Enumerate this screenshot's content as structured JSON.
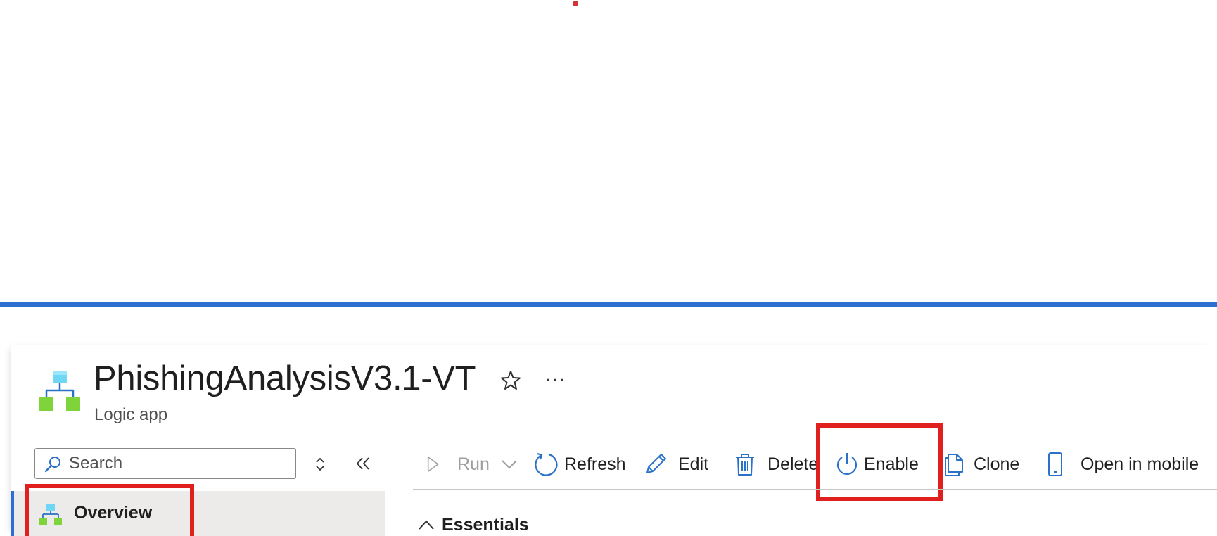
{
  "resource": {
    "title": "PhishingAnalysisV3.1-VT",
    "type": "Logic app",
    "icon": "logic-app-icon"
  },
  "header_actions": {
    "favorite_icon": "star-icon",
    "more_label": "···"
  },
  "sidebar": {
    "search_placeholder": "Search",
    "search_icon": "search-icon",
    "expand_icon": "up-down-chevron-icon",
    "collapse_icon": "double-chevron-left-icon",
    "items": [
      {
        "label": "Overview",
        "icon": "logic-app-icon",
        "selected": true
      }
    ]
  },
  "toolbar": {
    "run_label": "Run",
    "refresh_label": "Refresh",
    "edit_label": "Edit",
    "delete_label": "Delete",
    "enable_label": "Enable",
    "clone_label": "Clone",
    "open_mobile_label": "Open in mobile"
  },
  "main": {
    "essentials_label": "Essentials"
  },
  "colors": {
    "accent_blue": "#2c6fd1",
    "highlight_red": "#e0201f",
    "icon_blue": "#2a72c8",
    "icon_green": "#7fd43b",
    "icon_cyan": "#6fd6f6",
    "selected_bg": "#edebe9",
    "disabled_text": "#a19f9d"
  }
}
